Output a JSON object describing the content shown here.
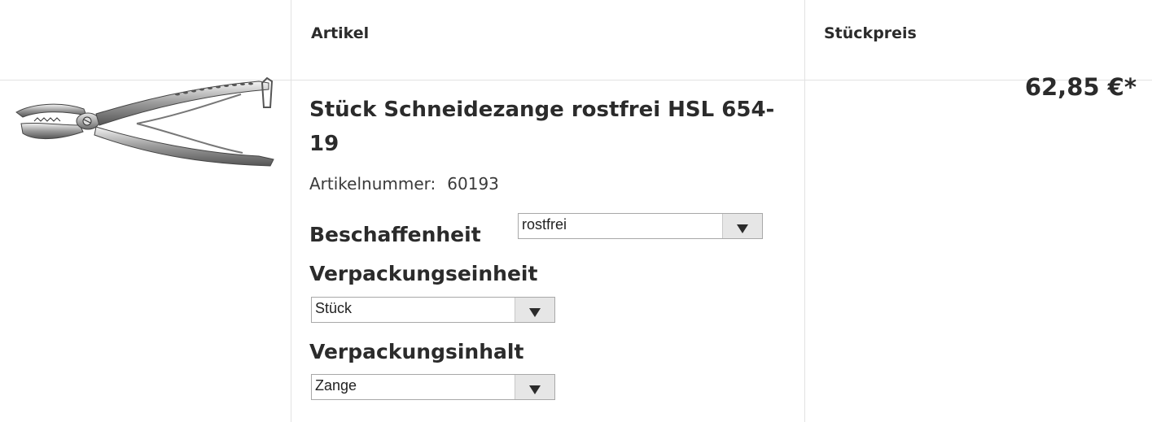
{
  "table": {
    "col_article_header": "Artikel",
    "col_price_header": "Stückpreis"
  },
  "product": {
    "image_icon": "pliers-image",
    "title": "Stück Schneidezange rostfrei HSL 654-19",
    "article_number_label": "Artikelnummer:",
    "article_number": "60193",
    "price": "62,85 €*"
  },
  "options": {
    "beschaffenheit": {
      "label": "Beschaffenheit",
      "selected": "rostfrei"
    },
    "verpackungseinheit": {
      "label": "Verpackungseinheit",
      "selected": "Stück"
    },
    "verpackungsinhalt": {
      "label": "Verpackungsinhalt",
      "selected": "Zange"
    }
  },
  "colors": {
    "text": "#2b2b2b",
    "border": "#e2e2e2",
    "select_button": "#e6e6e6"
  }
}
